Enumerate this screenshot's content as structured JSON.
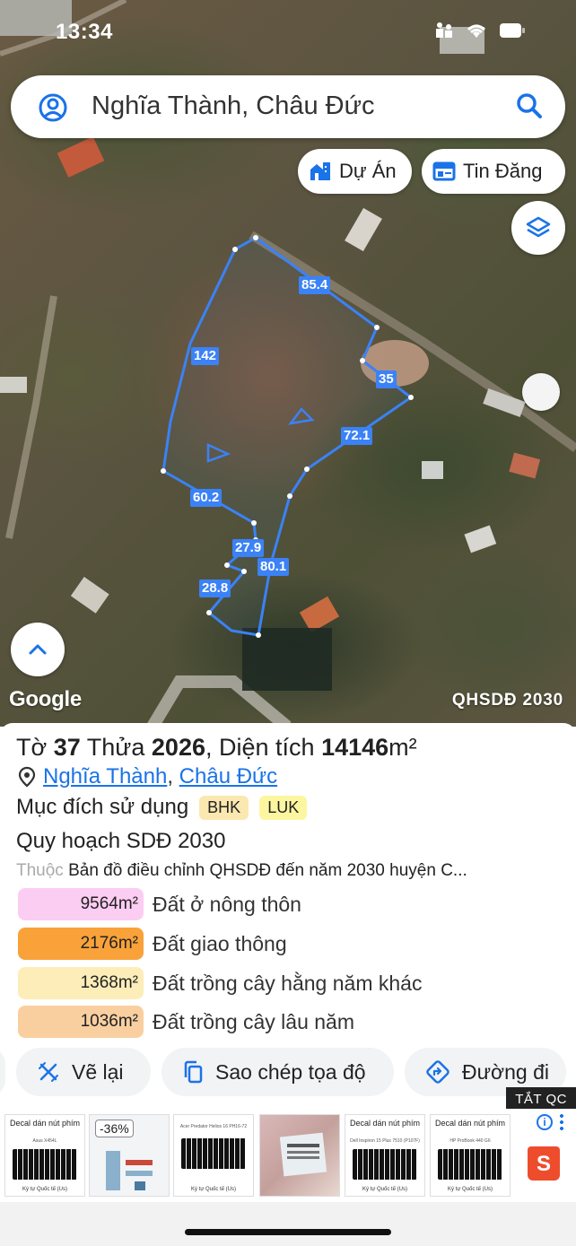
{
  "status_bar": {
    "time": "13:34"
  },
  "search": {
    "text": "Nghĩa Thành, Châu Đức"
  },
  "map_buttons": {
    "du_an": "Dự Án",
    "tin_dang": "Tin Đăng"
  },
  "map": {
    "edge_labels": [
      "85.4",
      "142",
      "35",
      "72.1",
      "60.2",
      "27.9",
      "80.1",
      "28.8"
    ],
    "attribution": "Google",
    "layer_name": "QHSDĐ 2030",
    "parcel_color": "#3b82f6"
  },
  "parcel": {
    "title_to": "Tờ",
    "to_number": "37",
    "title_thua": "Thửa",
    "thua_number": "2026",
    "title_area": ", Diện tích",
    "area": "14146",
    "area_unit": "m²",
    "commune": "Nghĩa Thành",
    "separator": ",",
    "district": "Châu Đức",
    "purpose_label": "Mục đích sử dụng",
    "purpose_codes": [
      {
        "code": "BHK",
        "color": "#fbe8b0"
      },
      {
        "code": "LUK",
        "color": "#fdf6a0"
      }
    ],
    "plan_title": "Quy hoạch SDĐ 2030",
    "belongs_label": "Thuộc",
    "belongs_text": "Bản đồ điều chỉnh QHSDĐ đến năm 2030 huyện C..."
  },
  "zones": [
    {
      "area": "9564m²",
      "name": "Đất ở nông thôn",
      "color": "#fccdf2"
    },
    {
      "area": "2176m²",
      "name": "Đất giao thông",
      "color": "#f9a23a"
    },
    {
      "area": "1368m²",
      "name": "Đất trồng cây hằng năm khác",
      "color": "#fdedb8"
    },
    {
      "area": "1036m²",
      "name": "Đất trồng cây lâu năm",
      "color": "#f9cfa0"
    }
  ],
  "actions": {
    "redraw": "Vẽ lại",
    "copy_coords": "Sao chép tọa độ",
    "directions": "Đường đi"
  },
  "ads": {
    "close_label": "TẮT QC",
    "discount": "-36%",
    "cards": [
      {
        "title": "Decal dán nút phím",
        "sub": "Asus X454L",
        "foot": "Ký tự Quốc tế (Us)"
      },
      {
        "title": "",
        "sub": "",
        "foot": ""
      },
      {
        "title": "",
        "sub": "Acer Predator Helios 16 PH16-72",
        "foot": "Ký tự Quốc tế (Us)"
      },
      {
        "title": "",
        "sub": "",
        "foot": ""
      },
      {
        "title": "Decal dán nút phím",
        "sub": "Dell Inspiron 15 Plus 7510 (P107F)",
        "foot": "Ký tự Quốc tế (Us)"
      },
      {
        "title": "Decal dán nút phím",
        "sub": "HP ProBook 440 G6",
        "foot": "Ký tự Quốc tế (Us)"
      }
    ]
  }
}
